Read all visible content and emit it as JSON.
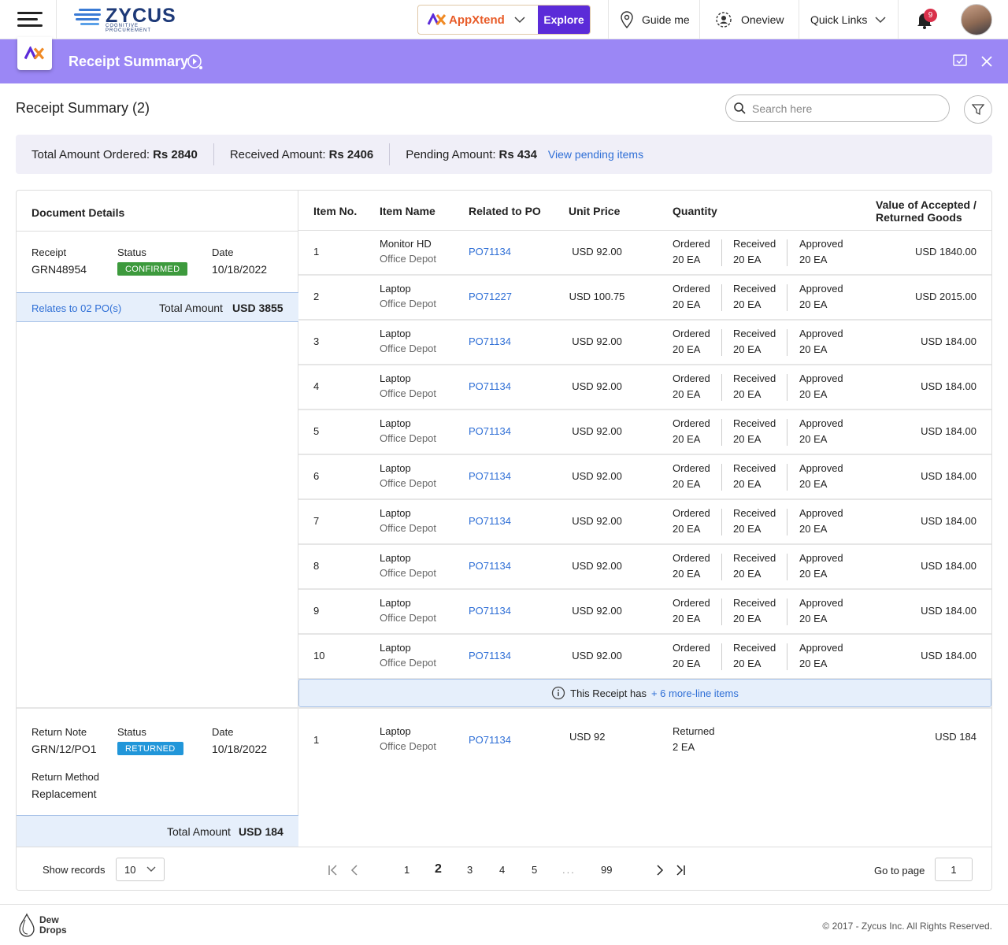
{
  "topbar": {
    "brand": "ZYCUS",
    "brand_sub": "COGNITIVE PROCUREMENT",
    "appxtend": "AppXtend",
    "explore": "Explore",
    "guide_me": "Guide me",
    "oneview": "Oneview",
    "quick_links": "Quick Links",
    "notifications_count": "9"
  },
  "header": {
    "title": "Receipt Summary"
  },
  "page": {
    "title": "Receipt Summary (2)",
    "search_placeholder": "Search here"
  },
  "summary": {
    "ordered_label": "Total Amount Ordered:",
    "ordered_value": "Rs 2840",
    "received_label": "Received Amount:",
    "received_value": "Rs 2406",
    "pending_label": "Pending Amount:",
    "pending_value": "Rs 434",
    "pending_link": "View pending items"
  },
  "doc": {
    "heading": "Document Details",
    "receipt_label": "Receipt",
    "receipt_value": "GRN48954",
    "status_label": "Status",
    "status_value": "CONFIRMED",
    "date_label": "Date",
    "date_value": "10/18/2022",
    "relates": "Relates to 02 PO(s)",
    "total_label": "Total Amount",
    "total_value": "USD 3855",
    "return_label": "Return Note",
    "return_value": "GRN/12/PO1",
    "return_status_label": "Status",
    "return_status_value": "RETURNED",
    "return_date_label": "Date",
    "return_date_value": "10/18/2022",
    "method_label": "Return Method",
    "method_value": "Replacement",
    "return_total_label": "Total Amount",
    "return_total_value": "USD 184"
  },
  "table": {
    "headers": {
      "item_no": "Item No.",
      "item_name": "Item Name",
      "po": "Related to PO",
      "unit_price": "Unit Price",
      "quantity": "Quantity",
      "value": "Value of Accepted / Returned Goods"
    },
    "qty_labels": {
      "ordered": "Ordered",
      "received": "Received",
      "approved": "Approved"
    },
    "rows": [
      {
        "no": "1",
        "name": "Monitor HD",
        "vendor": "Office Depot",
        "po": "PO71134",
        "price": "USD 92.00",
        "ordered": "20 EA",
        "received": "20 EA",
        "approved": "20 EA",
        "value": "USD 1840.00"
      },
      {
        "no": "2",
        "name": "Laptop",
        "vendor": "Office Depot",
        "po": "PO71227",
        "price": "USD 100.75",
        "ordered": "20 EA",
        "received": "20 EA",
        "approved": "20 EA",
        "value": "USD 2015.00"
      },
      {
        "no": "3",
        "name": "Laptop",
        "vendor": "Office Depot",
        "po": "PO71134",
        "price": "USD 92.00",
        "ordered": "20 EA",
        "received": "20 EA",
        "approved": "20 EA",
        "value": "USD 184.00"
      },
      {
        "no": "4",
        "name": "Laptop",
        "vendor": "Office Depot",
        "po": "PO71134",
        "price": "USD 92.00",
        "ordered": "20 EA",
        "received": "20 EA",
        "approved": "20 EA",
        "value": "USD 184.00"
      },
      {
        "no": "5",
        "name": "Laptop",
        "vendor": "Office Depot",
        "po": "PO71134",
        "price": "USD 92.00",
        "ordered": "20 EA",
        "received": "20 EA",
        "approved": "20 EA",
        "value": "USD 184.00"
      },
      {
        "no": "6",
        "name": "Laptop",
        "vendor": "Office Depot",
        "po": "PO71134",
        "price": "USD 92.00",
        "ordered": "20 EA",
        "received": "20 EA",
        "approved": "20 EA",
        "value": "USD 184.00"
      },
      {
        "no": "7",
        "name": "Laptop",
        "vendor": "Office Depot",
        "po": "PO71134",
        "price": "USD 92.00",
        "ordered": "20 EA",
        "received": "20 EA",
        "approved": "20 EA",
        "value": "USD 184.00"
      },
      {
        "no": "8",
        "name": "Laptop",
        "vendor": "Office Depot",
        "po": "PO71134",
        "price": "USD 92.00",
        "ordered": "20 EA",
        "received": "20 EA",
        "approved": "20 EA",
        "value": "USD 184.00"
      },
      {
        "no": "9",
        "name": "Laptop",
        "vendor": "Office Depot",
        "po": "PO71134",
        "price": "USD 92.00",
        "ordered": "20 EA",
        "received": "20 EA",
        "approved": "20 EA",
        "value": "USD 184.00"
      },
      {
        "no": "10",
        "name": "Laptop",
        "vendor": "Office Depot",
        "po": "PO71134",
        "price": "USD 92.00",
        "ordered": "20 EA",
        "received": "20 EA",
        "approved": "20 EA",
        "value": "USD 184.00"
      }
    ],
    "more_text": "This Receipt has",
    "more_link": "+ 6 more-line items",
    "return_row": {
      "no": "1",
      "name": "Laptop",
      "vendor": "Office Depot",
      "po": "PO71134",
      "price": "USD 92",
      "returned_label": "Returned",
      "returned": "2 EA",
      "value": "USD 184"
    }
  },
  "pagination": {
    "show_records": "Show records",
    "records_value": "10",
    "pages": [
      "1",
      "2",
      "3",
      "4",
      "5",
      "...",
      "99"
    ],
    "current": "2",
    "goto_label": "Go to page",
    "goto_value": "1"
  },
  "footer": {
    "brand_line1": "Dew",
    "brand_line2": "Drops",
    "copyright": "© 2017 - Zycus Inc. All Rights Reserved."
  },
  "colors": {
    "accent": "#9b87f5",
    "explore": "#5b2bd8",
    "link": "#2f6fd6",
    "confirmed": "#3d9a3d",
    "returned": "#2196d9"
  }
}
